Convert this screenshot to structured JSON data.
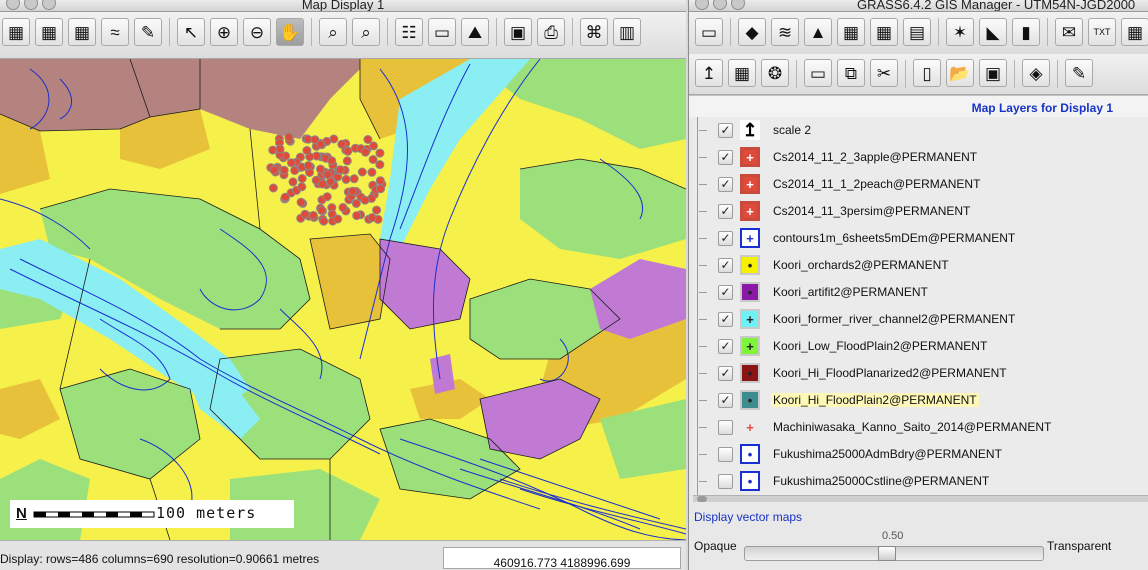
{
  "map_window": {
    "title": "Map Display 1",
    "toolbar": [
      {
        "name": "display-map-icon",
        "glyph": "▦"
      },
      {
        "name": "render-map-icon",
        "glyph": "▦"
      },
      {
        "name": "erase-display-icon",
        "glyph": "▦"
      },
      {
        "name": "draw-tool-icon",
        "glyph": "≈"
      },
      {
        "name": "redraw-icon",
        "glyph": "✎"
      },
      {
        "name": "pointer-icon",
        "glyph": "↖"
      },
      {
        "name": "zoom-in-icon",
        "glyph": "⊕"
      },
      {
        "name": "zoom-out-icon",
        "glyph": "⊖"
      },
      {
        "name": "pan-hand-icon",
        "glyph": "✋"
      },
      {
        "name": "zoom-back-icon",
        "glyph": "⌕"
      },
      {
        "name": "zoom-menu-icon",
        "glyph": "⌕"
      },
      {
        "name": "query-icon",
        "glyph": "☷"
      },
      {
        "name": "measure-icon",
        "glyph": "▭"
      },
      {
        "name": "profile-icon",
        "glyph": "⛰"
      },
      {
        "name": "save-display-icon",
        "glyph": "▣"
      },
      {
        "name": "print-icon",
        "glyph": "⎙"
      },
      {
        "name": "analysis-icon",
        "glyph": "⌘"
      },
      {
        "name": "decoration-icon",
        "glyph": "▥"
      }
    ],
    "active_tool": "pan-hand-icon",
    "scale_label": "100 meters",
    "north_arrow": "N",
    "status": "Display: rows=486  columns=690  resolution=0.90661 metres",
    "coordinates": "460916.773   4188996.699"
  },
  "manager_window": {
    "title": "GRASS6.4.2 GIS Manager - UTM54N-JGD2000",
    "toolbar_row1": [
      {
        "name": "new-display-icon",
        "glyph": "▭"
      },
      {
        "name": "raster-icon",
        "glyph": "◆"
      },
      {
        "name": "rgb-icon",
        "glyph": "≋"
      },
      {
        "name": "histogram-icon",
        "glyph": "▲"
      },
      {
        "name": "raster-legend-icon",
        "glyph": "▦"
      },
      {
        "name": "raster-thematic-icon",
        "glyph": "▦"
      },
      {
        "name": "raster-grid-icon",
        "glyph": "▤"
      },
      {
        "name": "vector-icon",
        "glyph": "✶"
      },
      {
        "name": "vector-thematic-icon",
        "glyph": "◣"
      },
      {
        "name": "chart-icon",
        "glyph": "▮"
      },
      {
        "name": "label-icon",
        "glyph": "✉"
      },
      {
        "name": "text-icon",
        "glyph": "TXT"
      },
      {
        "name": "scalebar-icon",
        "glyph": "▦"
      }
    ],
    "toolbar_row2": [
      {
        "name": "scale-north-icon",
        "glyph": "↥"
      },
      {
        "name": "grid-overlay-icon",
        "glyph": "▦"
      },
      {
        "name": "frame-icon",
        "glyph": "❂"
      },
      {
        "name": "group-folder-icon",
        "glyph": "▭"
      },
      {
        "name": "copy-icon",
        "glyph": "⧉"
      },
      {
        "name": "cut-icon",
        "glyph": "✂"
      },
      {
        "name": "new-file-icon",
        "glyph": "▯"
      },
      {
        "name": "open-file-icon",
        "glyph": "📂"
      },
      {
        "name": "save-file-icon",
        "glyph": "▣"
      },
      {
        "name": "georect-icon",
        "glyph": "◈"
      },
      {
        "name": "digitize-icon",
        "glyph": "✎"
      }
    ],
    "layers_header": "Map Layers for Display 1",
    "layers": [
      {
        "name": "scale 2",
        "checked": true,
        "icon": "scale-north-icon",
        "symbol": "↥",
        "color": "#000000",
        "fill": "#ffffff"
      },
      {
        "name": "Cs2014_11_2_3apple@PERMANENT",
        "checked": true,
        "icon": "point-layer-icon",
        "symbol": "+",
        "color": "#ffffff",
        "fill": "#e04a3a"
      },
      {
        "name": "Cs2014_11_1_2peach@PERMANENT",
        "checked": true,
        "icon": "point-layer-icon",
        "symbol": "+",
        "color": "#ffffff",
        "fill": "#e04a3a"
      },
      {
        "name": "Cs2014_11_3persim@PERMANENT",
        "checked": true,
        "icon": "point-layer-icon",
        "symbol": "+",
        "color": "#ffffff",
        "fill": "#e04a3a"
      },
      {
        "name": "contours1m_6sheets5mDEm@PERMANENT",
        "checked": true,
        "icon": "line-layer-icon",
        "symbol": "+",
        "color": "#1a2fcf",
        "fill": "#ffffff"
      },
      {
        "name": "Koori_orchards2@PERMANENT",
        "checked": true,
        "icon": "area-layer-icon",
        "symbol": "•",
        "color": "#222222",
        "fill": "#f6f100"
      },
      {
        "name": "Koori_artifit2@PERMANENT",
        "checked": true,
        "icon": "area-layer-icon",
        "symbol": "•",
        "color": "#222222",
        "fill": "#8a1aa6"
      },
      {
        "name": "Koori_former_river_channel2@PERMANENT",
        "checked": true,
        "icon": "area-layer-icon",
        "symbol": "+",
        "color": "#222222",
        "fill": "#6ef0f4"
      },
      {
        "name": "Koori_Low_FloodPlain2@PERMANENT",
        "checked": true,
        "icon": "area-layer-icon",
        "symbol": "+",
        "color": "#222222",
        "fill": "#7ef53a"
      },
      {
        "name": "Koori_Hi_FloodPlanarized2@PERMANENT",
        "checked": true,
        "icon": "area-layer-icon",
        "symbol": "•",
        "color": "#222222",
        "fill": "#8b1414"
      },
      {
        "name": "Koori_Hi_FloodPlain2@PERMANENT",
        "checked": true,
        "selected": true,
        "icon": "area-layer-icon",
        "symbol": "•",
        "color": "#222222",
        "fill": "#3e8c8e"
      },
      {
        "name": "Machiniwasaka_Kanno_Saito_2014@PERMANENT",
        "checked": false,
        "icon": "point-layer-icon",
        "symbol": "+",
        "color": "#e04a3a",
        "fill": "transparent"
      },
      {
        "name": "Fukushima25000AdmBdry@PERMANENT",
        "checked": false,
        "icon": "line-layer-icon",
        "symbol": "•",
        "color": "#1a2fcf",
        "fill": "#ffffff"
      },
      {
        "name": "Fukushima25000Cstline@PERMANENT",
        "checked": false,
        "icon": "line-layer-icon",
        "symbol": "•",
        "color": "#1a2fcf",
        "fill": "#ffffff"
      }
    ],
    "layer_info": "Display vector maps",
    "opacity": {
      "left_label": "Opaque",
      "right_label": "Transparent",
      "value": "0.50",
      "fraction": 0.5
    }
  }
}
